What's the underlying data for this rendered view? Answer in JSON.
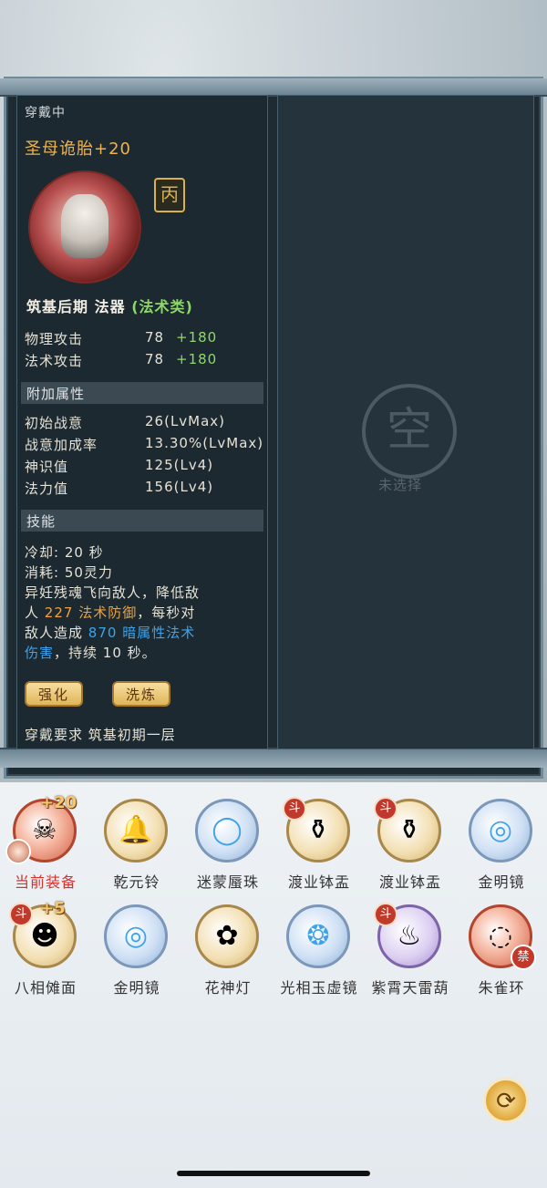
{
  "detail": {
    "wearing_label": "穿戴中",
    "item_name": "圣母诡胎+20",
    "seal_glyph": "丙",
    "realm": "筑基后期",
    "type": "法器",
    "category": "(法术类)",
    "base_stats": [
      {
        "label": "物理攻击",
        "value": "78",
        "bonus": "+180"
      },
      {
        "label": "法术攻击",
        "value": "78",
        "bonus": "+180"
      }
    ],
    "extra_title": "附加属性",
    "extra_stats": [
      {
        "label": "初始战意",
        "value": "26(LvMax)"
      },
      {
        "label": "战意加成率",
        "value": "13.30%(LvMax)"
      },
      {
        "label": "神识值",
        "value": "125(Lv4)"
      },
      {
        "label": "法力值",
        "value": "156(Lv4)"
      }
    ],
    "skill_title": "技能",
    "skill": {
      "cooldown": "冷却: 20 秒",
      "cost": "消耗: 50灵力",
      "line1": "异妊残魂飞向敌人，降低敌",
      "line2_a": "人 ",
      "line2_num": "227",
      "line2_b": " 法术防御",
      "line2_c": "，每秒对",
      "line3_a": "敌人造成 ",
      "line3_num": "870",
      "line3_b": " 暗属性法术",
      "line4_a": "伤害",
      "line4_b": "，持续 10 秒。"
    },
    "buttons": {
      "enhance": "强化",
      "refine": "洗炼"
    },
    "requirement": "穿戴要求  筑基初期一层"
  },
  "compare": {
    "empty_glyph": "空",
    "empty_label": "未选择"
  },
  "inventory": [
    {
      "name": "当前装备",
      "style": "red",
      "glyph": "☠",
      "plus": "+20",
      "current": true
    },
    {
      "name": "乾元铃",
      "style": "gold",
      "glyph": "🔔"
    },
    {
      "name": "迷蒙蜃珠",
      "style": "blue",
      "glyph": "◯"
    },
    {
      "name": "渡业钵盂",
      "style": "gold",
      "glyph": "⚱",
      "tag": "斗"
    },
    {
      "name": "渡业钵盂",
      "style": "gold",
      "glyph": "⚱",
      "tag": "斗"
    },
    {
      "name": "金明镜",
      "style": "blue",
      "glyph": "◎"
    },
    {
      "name": "八相傩面",
      "style": "gold",
      "glyph": "☻",
      "tag": "斗",
      "plus": "+5"
    },
    {
      "name": "金明镜",
      "style": "blue",
      "glyph": "◎"
    },
    {
      "name": "花神灯",
      "style": "gold",
      "glyph": "✿"
    },
    {
      "name": "光相玉虚镜",
      "style": "blue",
      "glyph": "❂"
    },
    {
      "name": "紫霄天雷葫",
      "style": "purple",
      "glyph": "♨",
      "tag": "斗"
    },
    {
      "name": "朱雀环",
      "style": "red",
      "glyph": "◌",
      "ban": "禁"
    }
  ],
  "swap_icon": "⟳"
}
